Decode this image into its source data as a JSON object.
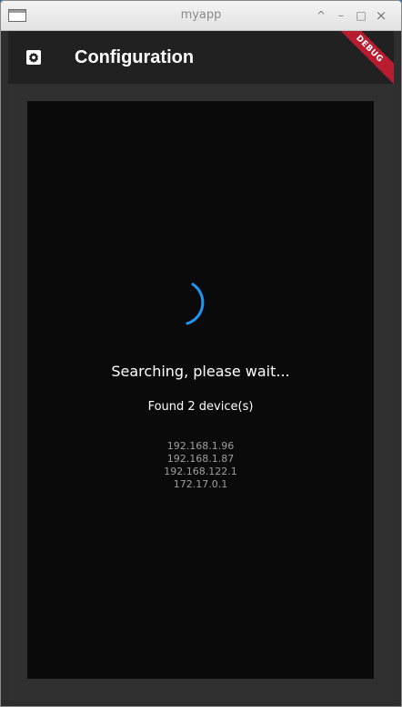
{
  "window": {
    "title": "myapp",
    "controls": {
      "shade": "^",
      "minimize": "–",
      "maximize": "□",
      "close": "×"
    }
  },
  "appbar": {
    "title": "Configuration",
    "settings_icon": "gear-icon",
    "debug_banner": "DEBUG"
  },
  "search": {
    "status": "Searching, please wait...",
    "found_label": "Found 2 device(s)",
    "devices": [
      "192.168.1.96",
      "192.168.1.87",
      "192.168.122.1",
      "172.17.0.1"
    ]
  },
  "colors": {
    "accent": "#2196f3",
    "appbar_background": "#212121",
    "panel_background": "#0a0a0a",
    "debug_ribbon": "#b71c2f"
  }
}
